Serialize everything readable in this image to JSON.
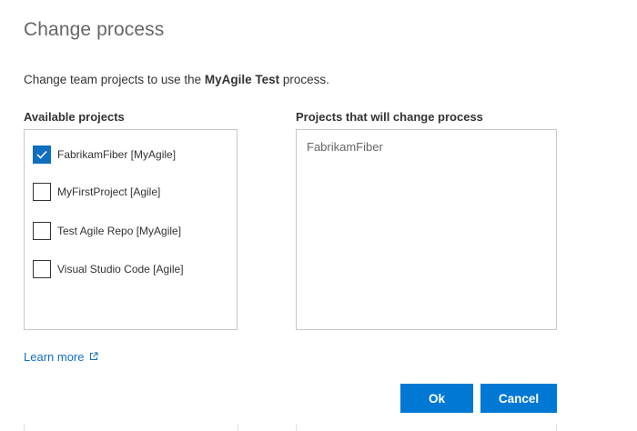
{
  "dialog": {
    "title": "Change process",
    "description": {
      "prefix": "Change team projects to use the ",
      "process_name": "MyAgile Test",
      "suffix": " process."
    }
  },
  "available_projects": {
    "heading": "Available projects",
    "items": [
      {
        "label": "FabrikamFiber [MyAgile]",
        "checked": true
      },
      {
        "label": "MyFirstProject [Agile]",
        "checked": false
      },
      {
        "label": "Test Agile Repo [MyAgile]",
        "checked": false
      },
      {
        "label": "Visual Studio Code [Agile]",
        "checked": false
      }
    ]
  },
  "changing_projects": {
    "heading": "Projects that will change process",
    "items": [
      "FabrikamFiber"
    ]
  },
  "learn_more": {
    "label": "Learn more",
    "icon": "external-link-icon"
  },
  "buttons": {
    "ok_label": "Ok",
    "cancel_label": "Cancel"
  },
  "colors": {
    "accent": "#0078d4",
    "checkbox_checked": "#106ebe",
    "link": "#106ebe",
    "title": "#666666",
    "text": "#333333",
    "border": "#c8c8c8"
  }
}
